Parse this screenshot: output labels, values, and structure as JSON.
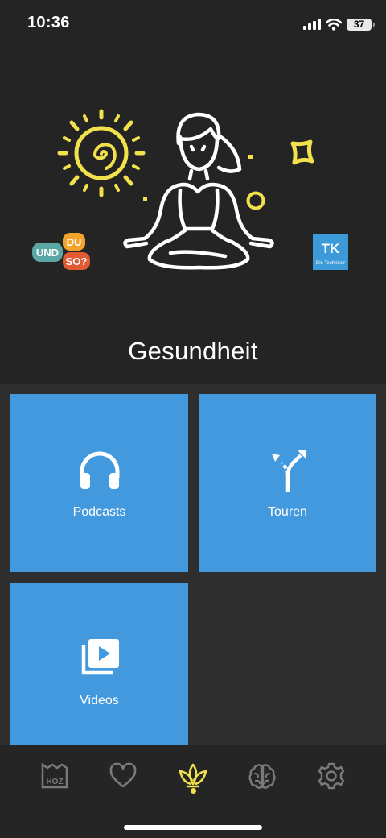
{
  "status_bar": {
    "time": "10:36",
    "battery": "37"
  },
  "hero": {
    "title": "Gesundheit",
    "badge_und_du_so": {
      "word_und": "UND",
      "word_du": "DU",
      "word_so": "SO?"
    },
    "badge_tk": {
      "logo": "TK",
      "caption": "Die Techniker"
    }
  },
  "tiles": [
    {
      "label": "Podcasts",
      "icon": "headphones-icon"
    },
    {
      "label": "Touren",
      "icon": "fork-arrows-icon"
    },
    {
      "label": "Videos",
      "icon": "video-library-icon"
    }
  ],
  "tabbar": {
    "items": [
      {
        "name": "hoz",
        "icon": "hoz-logo-icon",
        "label": "HOZ"
      },
      {
        "name": "favorites",
        "icon": "heart-icon"
      },
      {
        "name": "health",
        "icon": "lotus-icon",
        "active": true
      },
      {
        "name": "mind",
        "icon": "brain-icon"
      },
      {
        "name": "settings",
        "icon": "gear-icon"
      }
    ],
    "active_color": "#f1e14c",
    "inactive_color": "#7a7a7a"
  },
  "colors": {
    "background": "#242424",
    "tile": "#4299de",
    "accent": "#f1e14c"
  }
}
